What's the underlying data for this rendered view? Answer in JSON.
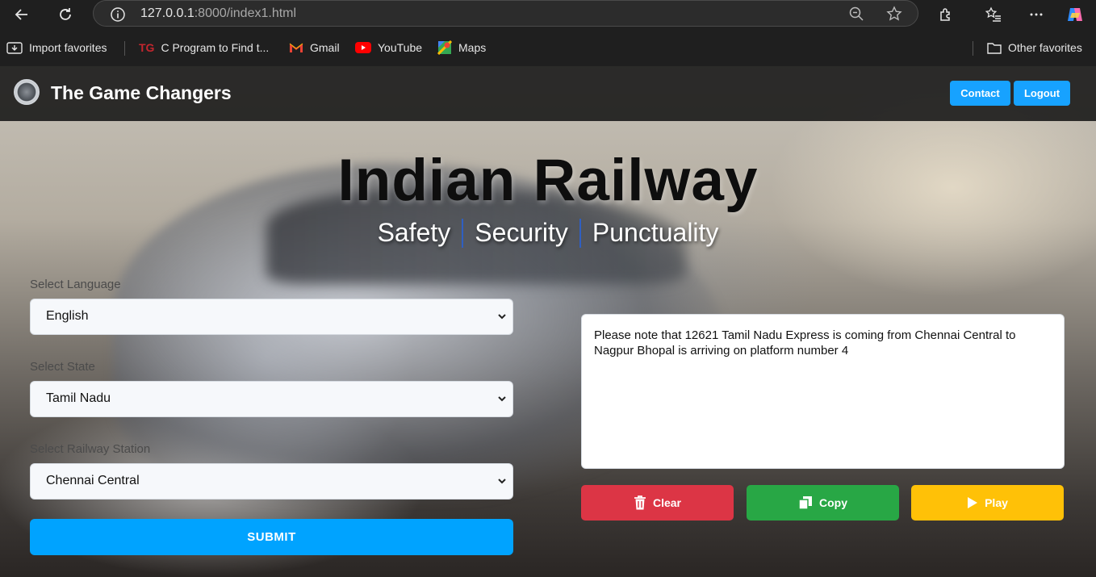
{
  "browser": {
    "url_host": "127.0.0.1",
    "url_rest": ":8000/index1.html",
    "favorites": [
      {
        "label": "Import favorites",
        "icon": "import-icon"
      },
      {
        "label": "C Program to Find t...",
        "icon": "tg-site-icon"
      },
      {
        "label": "Gmail",
        "icon": "gmail-icon"
      },
      {
        "label": "YouTube",
        "icon": "youtube-icon"
      },
      {
        "label": "Maps",
        "icon": "maps-icon"
      }
    ],
    "other_favorites": "Other favorites"
  },
  "nav": {
    "brand": "The Game Changers",
    "contact": "Contact",
    "logout": "Logout"
  },
  "hero": {
    "title": "Indian Railway",
    "taglines": [
      "Safety",
      "Security",
      "Punctuality"
    ]
  },
  "form": {
    "language_label": "Select Language",
    "language_value": "English",
    "state_label": "Select State",
    "state_value": "Tamil Nadu",
    "station_label": "Select Railway Station",
    "station_value": "Chennai Central",
    "submit": "SUBMIT"
  },
  "output": {
    "text": "Please note that 12621 Tamil Nadu Express is coming from Chennai Central to Nagpur Bhopal is arriving on platform number 4"
  },
  "actions": {
    "clear": "Clear",
    "copy": "Copy",
    "play": "Play"
  },
  "colors": {
    "primary": "#00a3ff",
    "clear": "#dc3545",
    "copy": "#28a745",
    "play": "#ffc107"
  }
}
